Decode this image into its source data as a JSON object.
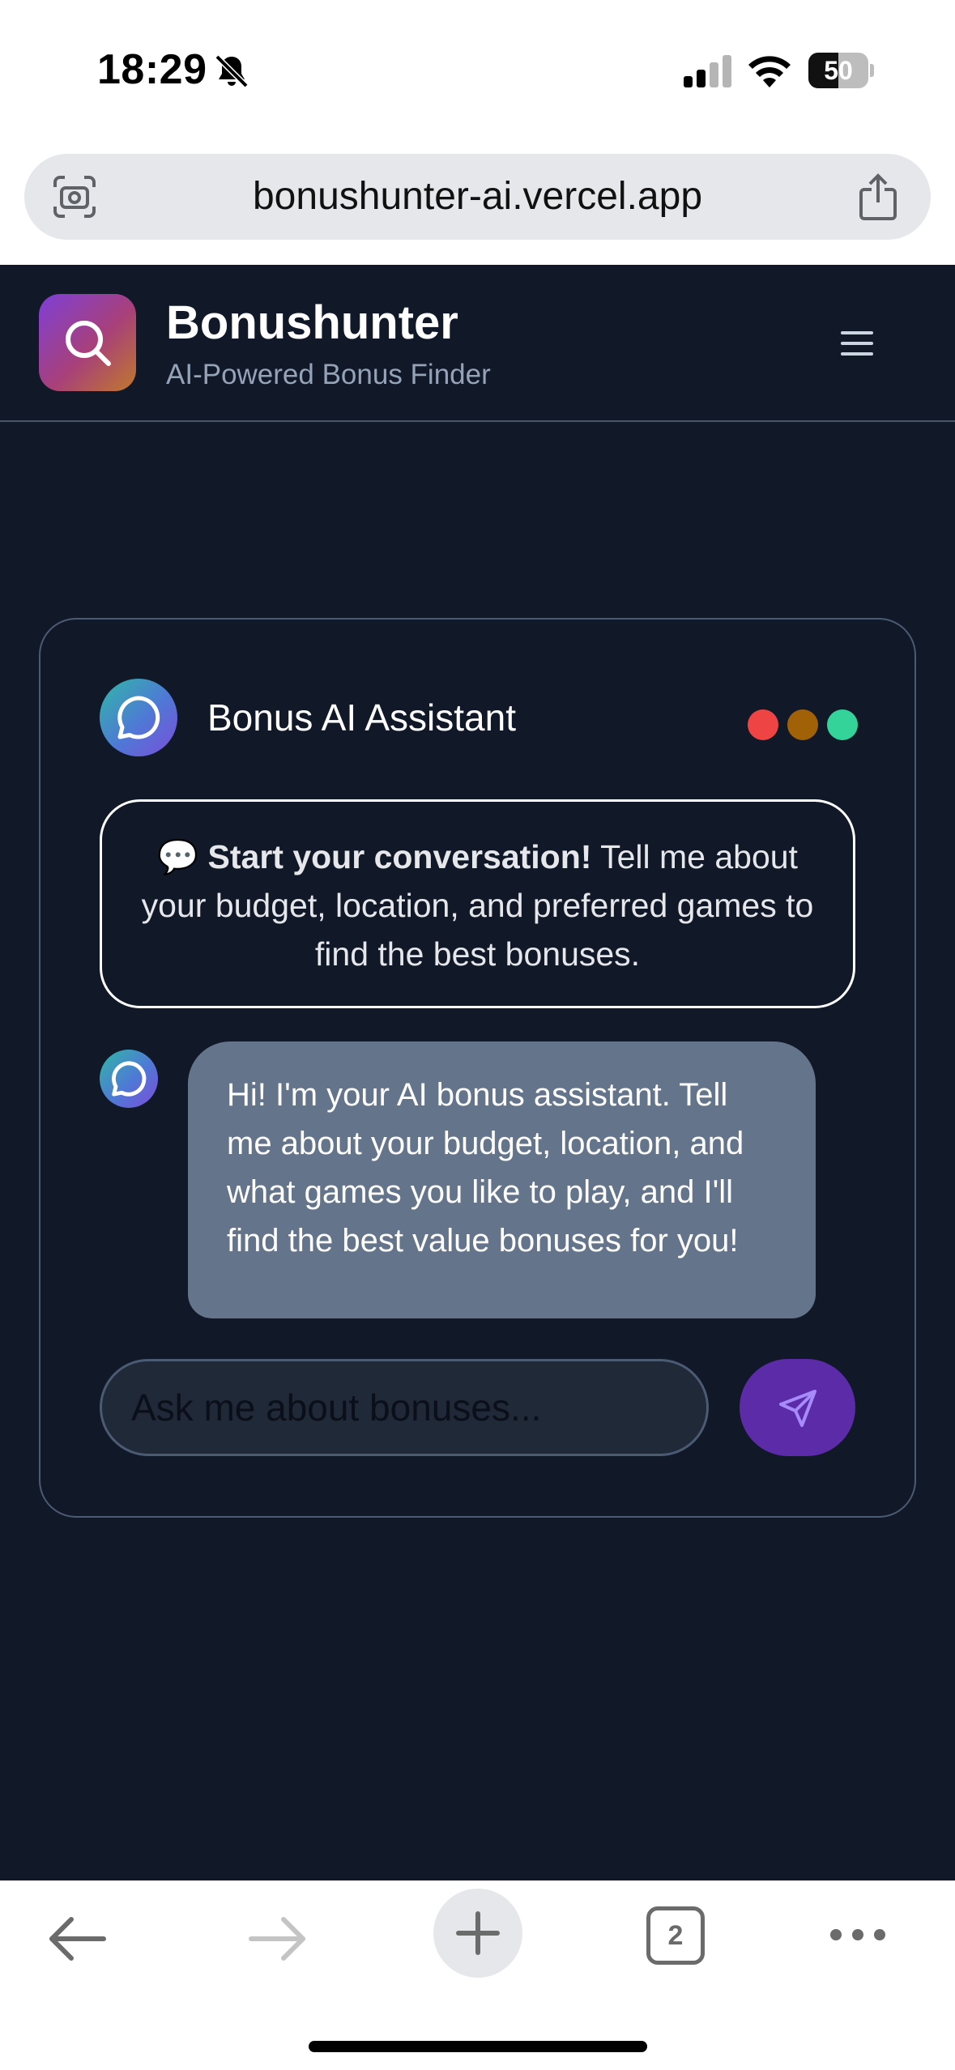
{
  "status_bar": {
    "time": "18:29",
    "battery": "50",
    "battery_percent": 50,
    "icons": [
      "mute-icon",
      "signal-icon",
      "wifi-icon",
      "battery-icon"
    ]
  },
  "browser": {
    "url": "bonushunter-ai.vercel.app",
    "open_tab_count": "2",
    "icons": [
      "scan-icon",
      "share-icon",
      "back-arrow-icon",
      "forward-arrow-icon",
      "plus-icon",
      "more-icon"
    ]
  },
  "header": {
    "title": "Bonushunter",
    "subtitle": "AI-Powered Bonus Finder",
    "logo_icon": "search-icon",
    "menu_icon": "hamburger-menu-icon"
  },
  "chat": {
    "title": "Bonus AI Assistant",
    "avatar_icon": "chat-bubble-icon",
    "window_dots": [
      "#ef4444",
      "#a16207",
      "#34d399"
    ],
    "intro": {
      "emoji": "💬",
      "bold": "Start your conversation!",
      "text": "Tell me about your budget, location, and preferred games to find the best bonuses."
    },
    "messages": [
      {
        "sender": "assistant",
        "text": "Hi! I'm your AI bonus assistant. Tell me about your budget, location, and what games you like to play, and I'll find the best value bonuses for you!"
      }
    ],
    "input": {
      "placeholder": "Ask me about bonuses...",
      "value": ""
    },
    "send_icon": "send-icon"
  },
  "colors": {
    "app_background": "#111827",
    "card_border": "#4b5b73",
    "bubble_background": "#64748b",
    "send_button": "#5b2ba8",
    "subtitle_text": "#94a3b8"
  }
}
